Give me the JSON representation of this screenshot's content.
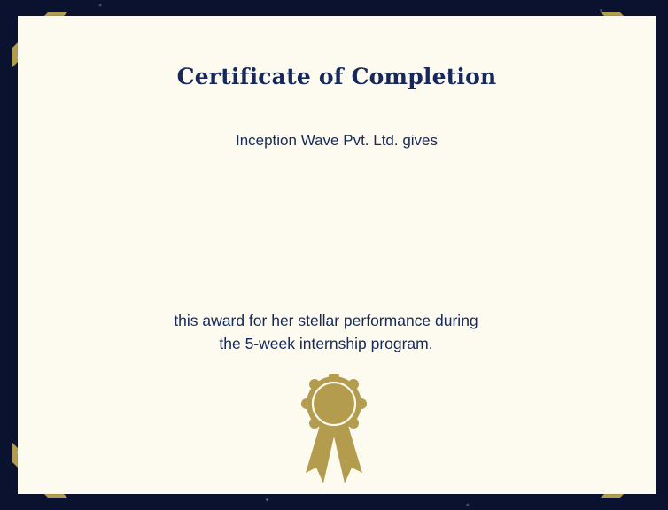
{
  "certificate": {
    "title": "Certificate of Completion",
    "issuer_line": "Inception Wave Pvt. Ltd. gives",
    "award_line_1": "this award for her stellar performance during",
    "award_line_2": "the 5-week internship program.",
    "seal_icon": "award-ribbon-icon"
  },
  "colors": {
    "paper": "#fdfbf0",
    "border": "#0b1230",
    "text": "#17285a",
    "gold": "#b39c4d"
  }
}
